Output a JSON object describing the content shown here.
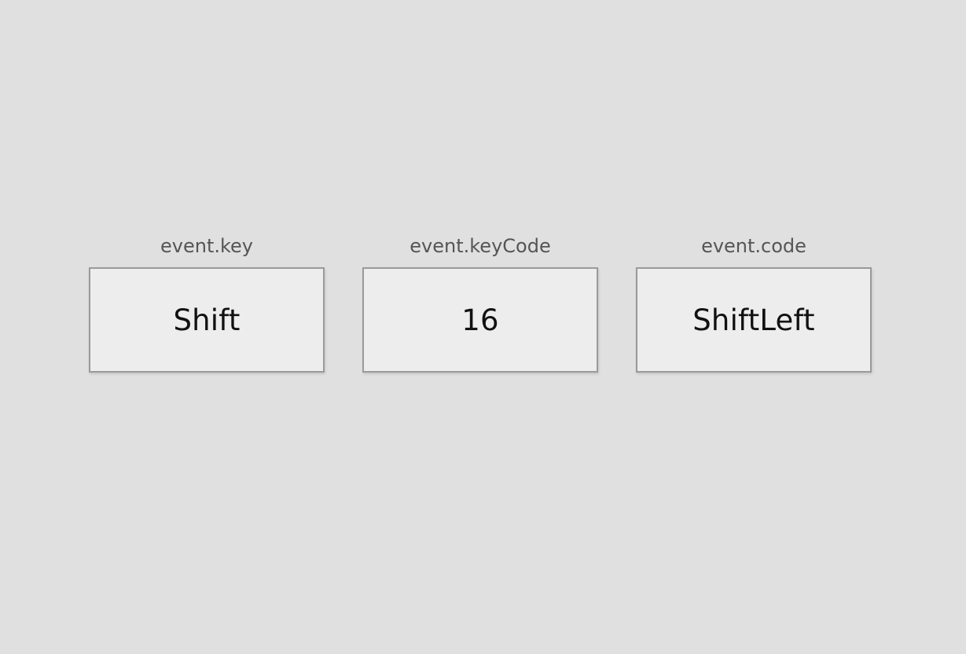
{
  "colors": {
    "background": "#e0e0e0",
    "box_background": "#ededed",
    "box_border": "#9a9a9a",
    "label_text": "#555555",
    "value_text": "#111111"
  },
  "key_info": [
    {
      "label": "event.key",
      "value": "Shift"
    },
    {
      "label": "event.keyCode",
      "value": "16"
    },
    {
      "label": "event.code",
      "value": "ShiftLeft"
    }
  ]
}
